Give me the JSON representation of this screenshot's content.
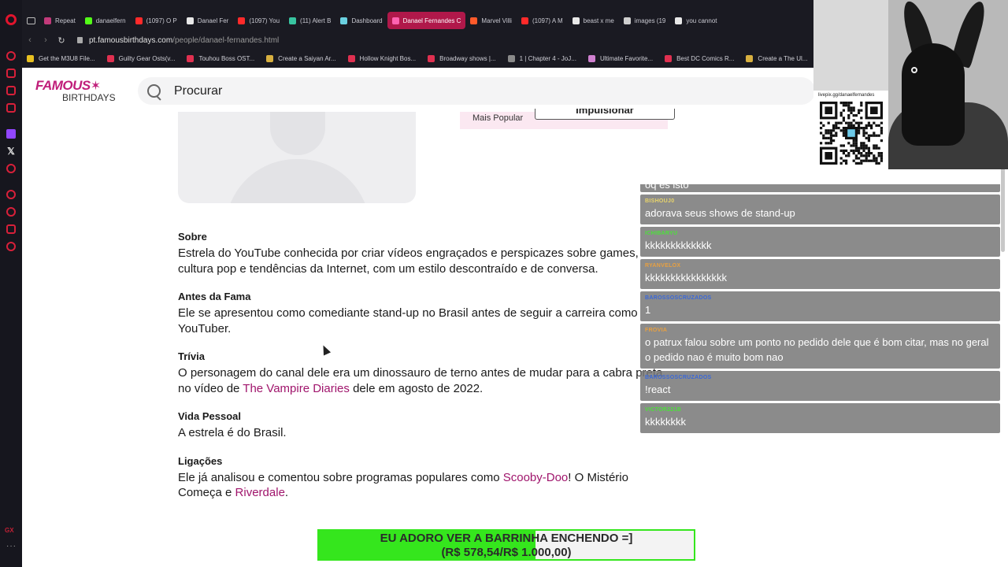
{
  "browser": {
    "tabs": [
      {
        "label": "Repeat",
        "color": "#c23a7a",
        "active": false
      },
      {
        "label": "danaelfern",
        "color": "#53fc18",
        "active": false
      },
      {
        "label": "(1097) O P",
        "color": "#ff2a2a",
        "active": false
      },
      {
        "label": "Danael Fer",
        "color": "#e8e8e8",
        "active": false
      },
      {
        "label": "(1097) You",
        "color": "#ff2a2a",
        "active": false
      },
      {
        "label": "(11) Alert B",
        "color": "#38c4a0",
        "active": false
      },
      {
        "label": "Dashboard",
        "color": "#6ad0e0",
        "active": false
      },
      {
        "label": "Danael Fernandes C",
        "color": "#ff62b0",
        "active": true
      },
      {
        "label": "Marvel Villi",
        "color": "#ff5a2a",
        "active": false
      },
      {
        "label": "(1097) A M",
        "color": "#ff2a2a",
        "active": false
      },
      {
        "label": "beast x me",
        "color": "#e8e8e8",
        "active": false
      },
      {
        "label": "images (19",
        "color": "#cfcfcf",
        "active": false
      },
      {
        "label": "you cannot",
        "color": "#e8e8e8",
        "active": false
      }
    ],
    "url_domain": "pt.famousbirthdays.com",
    "url_path": "/people/danael-fernandes.html",
    "bookmarks": [
      {
        "label": "Get the M3U8 File...",
        "color": "#e8c020"
      },
      {
        "label": "Guilty Gear Osts(v...",
        "color": "#e03050"
      },
      {
        "label": "Touhou Boss OST...",
        "color": "#e03050"
      },
      {
        "label": "Create a Saiyan Ar...",
        "color": "#d8b040"
      },
      {
        "label": "Hollow Knight Bos...",
        "color": "#e03050"
      },
      {
        "label": "Broadway shows |...",
        "color": "#e03050"
      },
      {
        "label": "1 | Chapter 4 - JoJ...",
        "color": "#8a8a8a"
      },
      {
        "label": "Ultimate Favorite...",
        "color": "#d080d0"
      },
      {
        "label": "Best DC Comics R...",
        "color": "#e03050"
      },
      {
        "label": "Create a The Ul...",
        "color": "#d8b040"
      }
    ]
  },
  "site": {
    "logo_top": "FAMOUS",
    "logo_bottom": "BIRTHDAYS",
    "search_placeholder": "Procurar",
    "promo_label": "Mais Popular",
    "promo_button": "Impulsionar"
  },
  "bio": {
    "about_title": "Sobre",
    "about_text": "Estrela do YouTube conhecida por criar vídeos engraçados e perspicazes sobre games, cultura pop e tendências da Internet, com um estilo descontraído e de conversa.",
    "before_title": "Antes da Fama",
    "before_text": "Ele se apresentou como comediante stand-up no Brasil antes de seguir a carreira como YouTuber.",
    "trivia_title": "Trívia",
    "trivia_pre": "O personagem do canal dele era um dinossauro de terno antes de mudar para a cabra preta no vídeo de ",
    "trivia_link": "The Vampire Diaries",
    "trivia_post": " dele em agosto de 2022.",
    "personal_title": "Vida Pessoal",
    "personal_text": "A estrela é do Brasil.",
    "links_title": "Ligações",
    "links_pre": "Ele já analisou e comentou sobre programas populares como ",
    "links_link1": "Scooby-Doo",
    "links_mid": "! O Mistério Começa e ",
    "links_link2": "Riverdale",
    "links_post": "."
  },
  "chat": {
    "messages": [
      {
        "user": "",
        "color": "#ffffff",
        "text": "oq es isto",
        "cut": true
      },
      {
        "user": "BISHOUJ0",
        "color": "#e8d46a",
        "text": "adorava seus shows de stand-up"
      },
      {
        "user": "ICHIBARYU",
        "color": "#4ce03a",
        "text": "kkkkkkkkkkkkk"
      },
      {
        "user": "RYANVELOX",
        "color": "#e8a040",
        "text": "kkkkkkkkkkkkkkkk"
      },
      {
        "user": "BAROSSOSCRUZADOS",
        "color": "#3a68d8",
        "text": "1"
      },
      {
        "user": "FROVIA",
        "color": "#e8a040",
        "text": "o patrux falou sobre um ponto no pedido dele que é bom citar, mas no geral o pedido nao é muito bom nao"
      },
      {
        "user": "BAROSSOSCRUZADOS",
        "color": "#3a68d8",
        "text": "!react"
      },
      {
        "user": "VICTOR221B",
        "color": "#4ce03a",
        "text": "kkkkkkkk"
      }
    ]
  },
  "overlay": {
    "qr_url": "livepix.gg/danaelfernandes",
    "goal_line1": "EU ADORO VER A BARRINHA ENCHENDO =]",
    "goal_line2": "(R$ 578,54/R$ 1.000,00)",
    "goal_progress": 0.5785,
    "goal_color": "#35e61d"
  }
}
